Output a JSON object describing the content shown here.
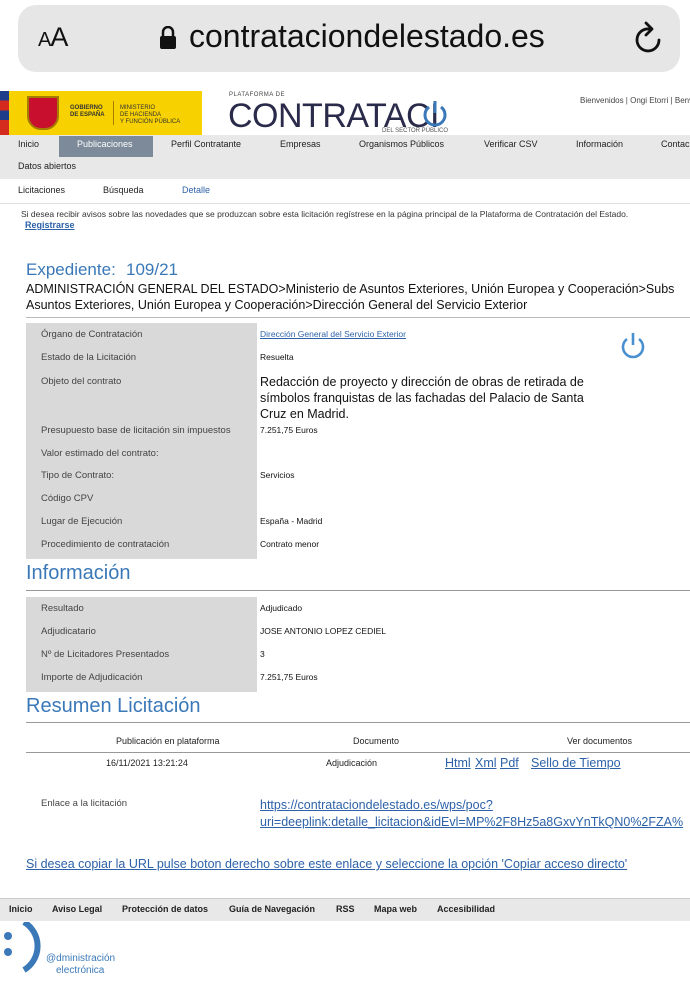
{
  "browser": {
    "aa_label": "AA",
    "url": "contrataciondelestado.es"
  },
  "header": {
    "gov_line1": "GOBIERNO\nDE ESPAÑA",
    "gov_line2": "MINISTERIO\nDE HACIENDA\nY FUNCIÓN PÚBLICA",
    "pdc_small": "PLATAFORMA DE",
    "pdc_big": "CONTRATACI",
    "pdc_sub": "DEL SECTOR PÚBLICO",
    "user_links": "Bienvenidos | Ongi Etorri | Benv"
  },
  "nav": {
    "items": [
      "Inicio",
      "Publicaciones",
      "Perfil Contratante",
      "Empresas",
      "Organismos Públicos",
      "Verificar CSV",
      "Información",
      "Contac"
    ],
    "row2": "Datos abiertos",
    "active": "Publicaciones"
  },
  "subnav": {
    "items": [
      "Licitaciones",
      "Búsqueda",
      "Detalle"
    ]
  },
  "notice": {
    "text": "Si desea recibir avisos sobre las novedades que se produzcan sobre esta licitación regístrese en la página principal de la Plataforma de Contratación del Estado.",
    "link": "Registrarse"
  },
  "expediente": {
    "label": "Expediente:",
    "number": "109/21",
    "path_line1": "ADMINISTRACIÓN GENERAL DEL ESTADO>Ministerio de Asuntos Exteriores, Unión Europea y Cooperación>Subs",
    "path_line2": "Asuntos Exteriores, Unión Europea y Cooperación>Dirección General del Servicio Exterior"
  },
  "details": [
    {
      "label": "Órgano de Contratación",
      "value": "Dirección General del Servicio Exterior"
    },
    {
      "label": "Estado de la Licitación",
      "value": "Resuelta"
    },
    {
      "label": "Objeto del contrato",
      "value": "Redacción de proyecto y dirección de obras de retirada de símbolos franquistas de las fachadas del Palacio de Santa Cruz en Madrid."
    },
    {
      "label": "Presupuesto base de licitación sin impuestos",
      "value": "7.251,75   Euros"
    },
    {
      "label": "Valor estimado del contrato:",
      "value": ""
    },
    {
      "label": "Tipo de Contrato:",
      "value": "Servicios"
    },
    {
      "label": "Código CPV",
      "value": ""
    },
    {
      "label": "Lugar de Ejecución",
      "value": "España - Madrid"
    },
    {
      "label": "Procedimiento de contratación",
      "value": "Contrato menor"
    }
  ],
  "informacion": {
    "title": "Información",
    "rows": [
      {
        "label": "Resultado",
        "value": "Adjudicado"
      },
      {
        "label": "Adjudicatario",
        "value": "JOSE ANTONIO LOPEZ CEDIEL"
      },
      {
        "label": "Nº de Licitadores Presentados",
        "value": "3"
      },
      {
        "label": "Importe de Adjudicación",
        "value": "7.251,75   Euros"
      }
    ]
  },
  "resumen": {
    "title": "Resumen Licitación",
    "headers": [
      "Publicación en plataforma",
      "Documento",
      "Ver documentos"
    ],
    "row": {
      "date": "16/11/2021 13:21:24",
      "document": "Adjudicación",
      "links": [
        "Html",
        "Xml",
        "Pdf",
        "Sello de Tiempo"
      ]
    }
  },
  "enlace": {
    "label": "Enlace a la licitación",
    "url_line1": "https://contrataciondelestado.es/wps/poc?",
    "url_line2": "uri=deeplink:detalle_licitacion&idEvl=MP%2F8Hz5a8GxvYnTkQN0%2FZA%"
  },
  "copy_note": "Si desea copiar la URL pulse boton derecho sobre este enlace y seleccione la opción 'Copiar acceso directo'",
  "footer": {
    "items": [
      "Inicio",
      "Aviso Legal",
      "Protección de datos",
      "Guía de Navegación",
      "RSS",
      "Mapa web",
      "Accesibilidad"
    ]
  },
  "ae_logo": {
    "line1": "@dministración",
    "line2": "electrónica"
  }
}
